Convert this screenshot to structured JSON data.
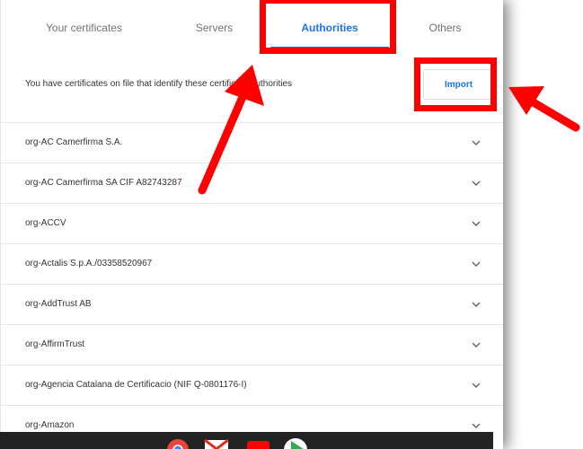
{
  "tabs": [
    {
      "label": "Your certificates",
      "active": false
    },
    {
      "label": "Servers",
      "active": false
    },
    {
      "label": "Authorities",
      "active": true
    },
    {
      "label": "Others",
      "active": false
    }
  ],
  "info_text": "You have certificates on file that identify these certificate authorities",
  "import_label": "Import",
  "authorities": [
    "org-AC Camerfirma S.A.",
    "org-AC Camerfirma SA CIF A82743287",
    "org-ACCV",
    "org-Actalis S.p.A./03358520967",
    "org-AddTrust AB",
    "org-AffirmTrust",
    "org-Agencia Catalana de Certificacio (NIF Q-0801176-I)",
    "org-Amazon"
  ],
  "shelf_apps": [
    "chrome-icon",
    "gmail-icon",
    "youtube-icon",
    "play-store-icon"
  ],
  "colors": {
    "accent": "#1a73e8",
    "annotation": "#ff0000",
    "shelf": "#232323"
  }
}
